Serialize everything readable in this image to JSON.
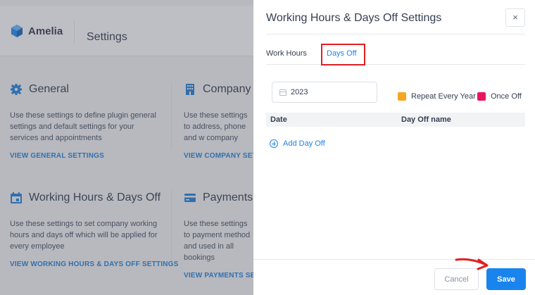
{
  "app": {
    "brand": "Amelia",
    "page_title": "Settings"
  },
  "cards": [
    {
      "title": "General",
      "icon": "gear-icon",
      "description": "Use these settings to define plugin general settings and default settings for your services and appointments",
      "link": "VIEW GENERAL SETTINGS"
    },
    {
      "title": "Company",
      "icon": "building-icon",
      "description": "Use these settings to address, phone and w company",
      "link": "VIEW COMPANY SETTI"
    },
    {
      "title": "Working Hours & Days Off",
      "icon": "calendar-icon",
      "description": "Use these settings to set company working hours and days off which will be applied for every employee",
      "link": "VIEW WORKING HOURS & DAYS OFF SETTINGS"
    },
    {
      "title": "Payments",
      "icon": "credit-card-icon",
      "description": "Use these settings to payment method and used in all bookings",
      "link": "VIEW PAYMENTS SETT"
    }
  ],
  "modal": {
    "title": "Working Hours & Days Off Settings",
    "close_label": "×",
    "tabs": [
      {
        "label": "Work Hours",
        "active": false
      },
      {
        "label": "Days Off",
        "active": true
      }
    ],
    "year_value": "2023",
    "legend": [
      {
        "label": "Repeat Every Year",
        "color": "#f5a623"
      },
      {
        "label": "Once Off",
        "color": "#e8175d"
      }
    ],
    "table": {
      "columns": [
        "Date",
        "Day Off name"
      ],
      "rows": []
    },
    "add_day_off_label": "Add Day Off",
    "cancel_label": "Cancel",
    "save_label": "Save"
  },
  "colors": {
    "accent": "#1a84ee",
    "highlight_box": "#e02020",
    "arrow": "#e02020",
    "link": "#1a7ad9"
  }
}
